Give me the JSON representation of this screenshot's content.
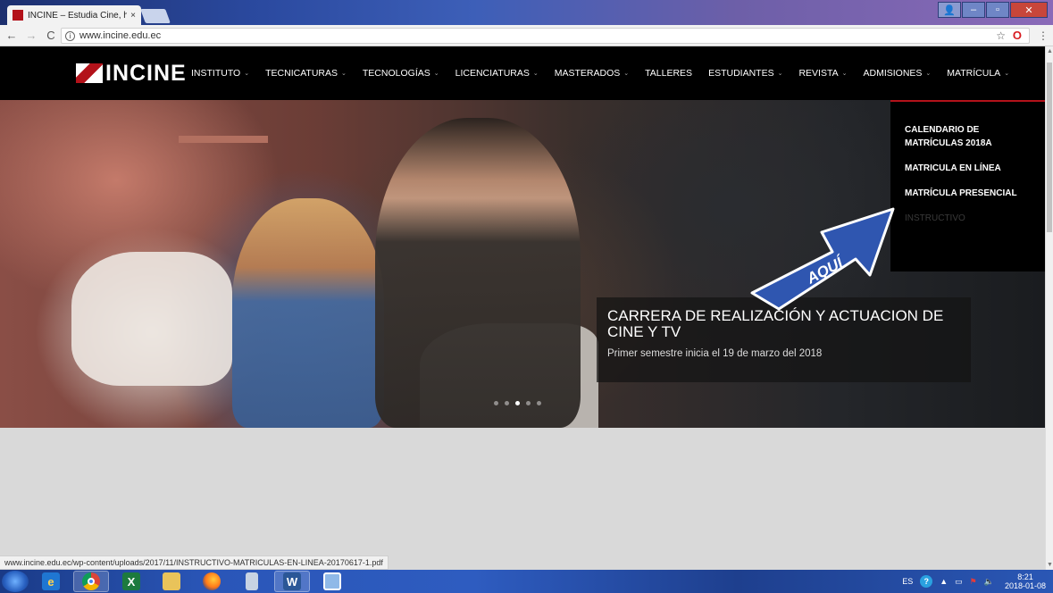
{
  "browser": {
    "tab_title": "INCINE – Estudia Cine, ho",
    "tab_close": "×",
    "url": "www.incine.edu.ec",
    "info_glyph": "i",
    "back_glyph": "←",
    "forward_glyph": "→",
    "reload_glyph": "C",
    "star_glyph": "☆",
    "opera_glyph": "O",
    "menu_glyph": "⋮",
    "win_minimize": "–",
    "win_maximize": "▫",
    "win_close": "✕",
    "win_user": "👤"
  },
  "site": {
    "logo_text": "INCINE",
    "menu": [
      {
        "label": "INSTITUTO",
        "has_chevron": true
      },
      {
        "label": "TECNICATURAS",
        "has_chevron": true
      },
      {
        "label": "TECNOLOGÍAS",
        "has_chevron": true
      },
      {
        "label": "LICENCIATURAS",
        "has_chevron": true
      },
      {
        "label": "MASTERADOS",
        "has_chevron": true
      },
      {
        "label": "TALLERES",
        "has_chevron": false
      },
      {
        "label": "ESTUDIANTES",
        "has_chevron": true
      },
      {
        "label": "REVISTA",
        "has_chevron": true
      },
      {
        "label": "ADMISIONES",
        "has_chevron": true
      },
      {
        "label": "MATRÍCULA",
        "has_chevron": true
      }
    ],
    "chevron_glyph": "⌄",
    "dropdown": [
      "CALENDARIO DE MATRÍCULAS 2018A",
      "MATRICULA EN LÍNEA",
      "MATRÍCULA PRESENCIAL",
      "INSTRUCTIVO"
    ],
    "hero": {
      "title": "CARRERA DE REALIZACIÓN Y ACTUACION DE CINE Y TV",
      "subtitle": "Primer semestre inicia el 19 de marzo del 2018",
      "slide_count": 5,
      "active_slide": 3
    },
    "annotation_text": "AQUÍ",
    "accent_color": "#b3121a",
    "annotation_color": "#2f56b0"
  },
  "status_bar": "www.incine.edu.ec/wp-content/uploads/2017/11/INSTRUCTIVO-MATRICULAS-EN-LINEA-20170617-1.pdf",
  "taskbar": {
    "apps": [
      "start-orb",
      "internet-explorer-icon",
      "chrome-icon",
      "excel-icon",
      "file-explorer-icon",
      "firefox-icon",
      "calculator-icon",
      "word-icon",
      "picture-viewer-icon"
    ],
    "tray_language": "ES",
    "clock_time": "8:21",
    "clock_date": "2018-01-08"
  }
}
